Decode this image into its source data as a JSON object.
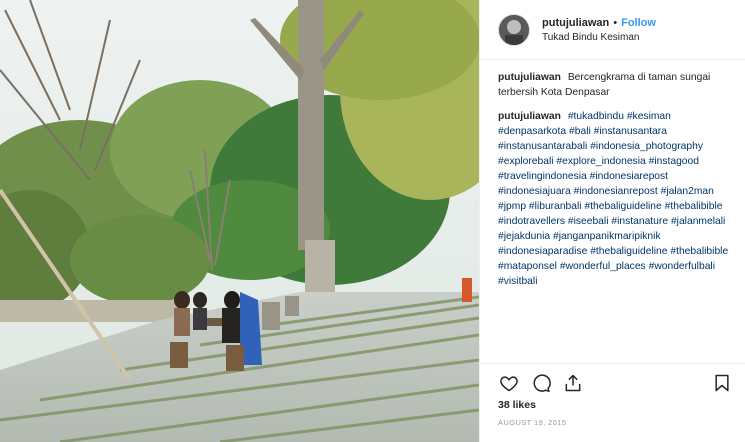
{
  "header": {
    "username": "putujuliawan",
    "separator": "•",
    "follow_label": "Follow",
    "location": "Tukad Bindu Kesiman"
  },
  "caption": {
    "username": "putujuliawan",
    "text": "Bercengkrama di taman sungai terbersih Kota Denpasar"
  },
  "tags_comment": {
    "username": "putujuliawan",
    "tags": [
      "#tukadbindu",
      "#kesiman",
      "#denpasarkota",
      "#bali",
      "#instanusantara",
      "#instanusantarabali",
      "#indonesia_photography",
      "#explorebali",
      "#explore_indonesia",
      "#instagood",
      "#travelingindonesia",
      "#indonesiarepost",
      "#indonesiajuara",
      "#indonesianrepost",
      "#jalan2man",
      "#jpmp",
      "#liburanbali",
      "#thebaliguideline",
      "#thebalibible",
      "#indotravellers",
      "#iseebali",
      "#instanature",
      "#jalanmelali",
      "#jejakdunia",
      "#janganpanikmaripiknik",
      "#indonesiaparadise",
      "#thebaliguideline",
      "#thebalibible",
      "#mataponsel",
      "#wonderful_places",
      "#wonderfulbali",
      "#visitbali"
    ]
  },
  "actions": {
    "like": "heart-icon",
    "comment": "comment-icon",
    "share": "share-icon",
    "save": "bookmark-icon"
  },
  "likes_text": "38 likes",
  "date_text": "AUGUST 19, 2015",
  "colors": {
    "link": "#3897f0",
    "hashtag": "#003569",
    "border": "#efefef"
  }
}
